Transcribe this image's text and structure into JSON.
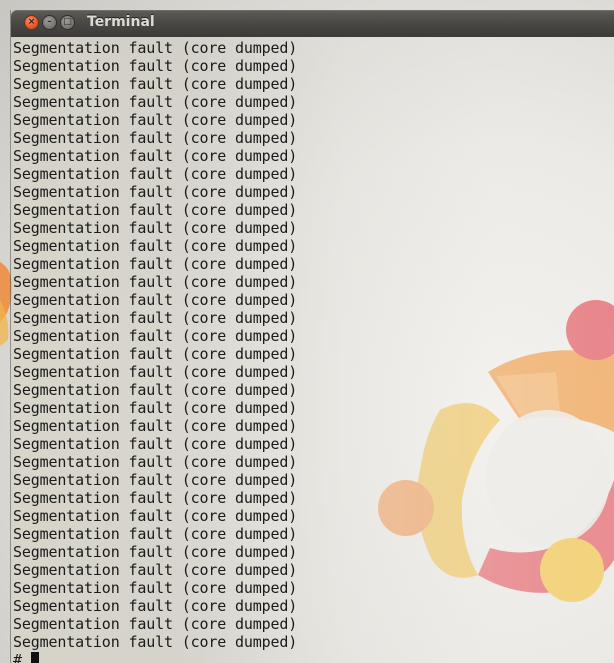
{
  "window": {
    "title": "Terminal",
    "buttons": {
      "close_glyph": "×",
      "minimize_glyph": "–",
      "maximize_glyph": "□"
    }
  },
  "terminal": {
    "lines": [
      "Segmentation fault (core dumped)",
      "Segmentation fault (core dumped)",
      "Segmentation fault (core dumped)",
      "Segmentation fault (core dumped)",
      "Segmentation fault (core dumped)",
      "Segmentation fault (core dumped)",
      "Segmentation fault (core dumped)",
      "Segmentation fault (core dumped)",
      "Segmentation fault (core dumped)",
      "Segmentation fault (core dumped)",
      "Segmentation fault (core dumped)",
      "Segmentation fault (core dumped)",
      "Segmentation fault (core dumped)",
      "Segmentation fault (core dumped)",
      "Segmentation fault (core dumped)",
      "Segmentation fault (core dumped)",
      "Segmentation fault (core dumped)",
      "Segmentation fault (core dumped)",
      "Segmentation fault (core dumped)",
      "Segmentation fault (core dumped)",
      "Segmentation fault (core dumped)",
      "Segmentation fault (core dumped)",
      "Segmentation fault (core dumped)",
      "Segmentation fault (core dumped)",
      "Segmentation fault (core dumped)",
      "Segmentation fault (core dumped)",
      "Segmentation fault (core dumped)",
      "Segmentation fault (core dumped)",
      "Segmentation fault (core dumped)",
      "Segmentation fault (core dumped)",
      "Segmentation fault (core dumped)",
      "Segmentation fault (core dumped)",
      "Segmentation fault (core dumped)",
      "Segmentation fault (core dumped)"
    ],
    "prompt": "# "
  },
  "colors": {
    "close_button": "#e55a2c",
    "titlebar": "#3c3b37",
    "title_text": "#dfdbd2",
    "terminal_text": "#1a1a1a",
    "logo_orange": "#f29a4a",
    "logo_yellow": "#f2c24e",
    "logo_red": "#e5646c"
  },
  "icons": {
    "close": "close-icon",
    "minimize": "minimize-icon",
    "maximize": "maximize-icon",
    "wallpaper": "ubuntu-logo-icon"
  }
}
